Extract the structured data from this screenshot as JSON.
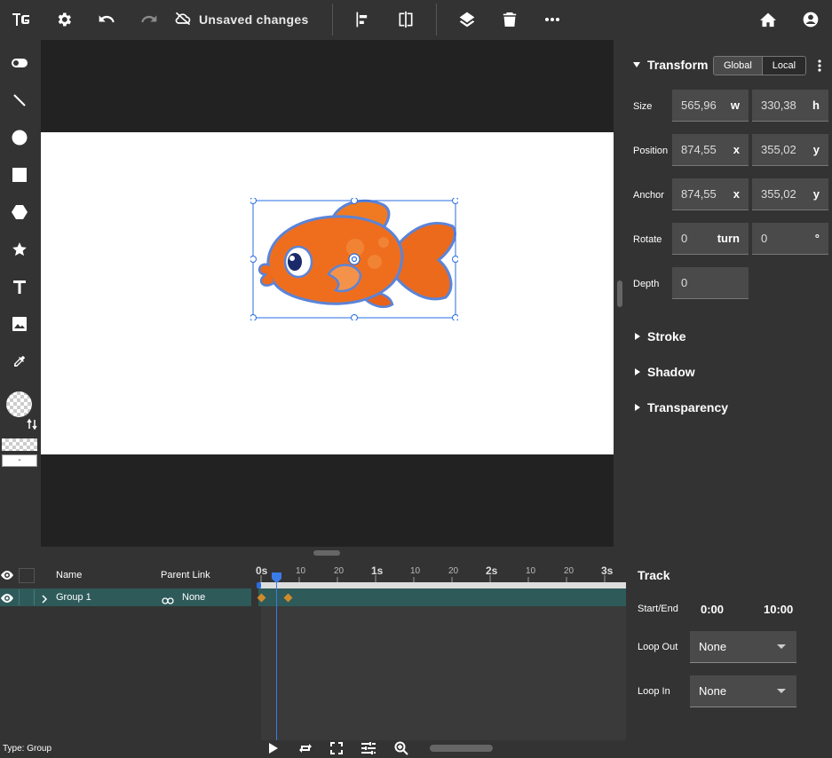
{
  "topbar": {
    "unsaved_label": "Unsaved changes"
  },
  "transform": {
    "title": "Transform",
    "global_label": "Global",
    "local_label": "Local",
    "size": {
      "label": "Size",
      "w": "565,96",
      "w_unit": "w",
      "h": "330,38",
      "h_unit": "h"
    },
    "position": {
      "label": "Position",
      "x": "874,55",
      "x_unit": "x",
      "y": "355,02",
      "y_unit": "y"
    },
    "anchor": {
      "label": "Anchor",
      "x": "874,55",
      "x_unit": "x",
      "y": "355,02",
      "y_unit": "y"
    },
    "rotate": {
      "label": "Rotate",
      "turn": "0",
      "turn_unit": "turn",
      "deg": "0",
      "deg_unit": "°"
    },
    "depth": {
      "label": "Depth",
      "value": "0"
    }
  },
  "sections": {
    "stroke": "Stroke",
    "shadow": "Shadow",
    "transparency": "Transparency"
  },
  "color_swatch_label": "-",
  "layers": {
    "name_header": "Name",
    "parent_header": "Parent Link",
    "rows": [
      {
        "name": "Group 1",
        "parent": "None"
      }
    ]
  },
  "ruler": {
    "ticks": [
      "0s",
      "10",
      "20",
      "1s",
      "10",
      "20",
      "2s",
      "10",
      "20",
      "3s"
    ]
  },
  "track": {
    "title": "Track",
    "startend_label": "Start/End",
    "start": "0:00",
    "end": "10:00",
    "loop_out_label": "Loop Out",
    "loop_out_value": "None",
    "loop_in_label": "Loop In",
    "loop_in_value": "None"
  },
  "status": {
    "type_label": "Type: Group"
  }
}
